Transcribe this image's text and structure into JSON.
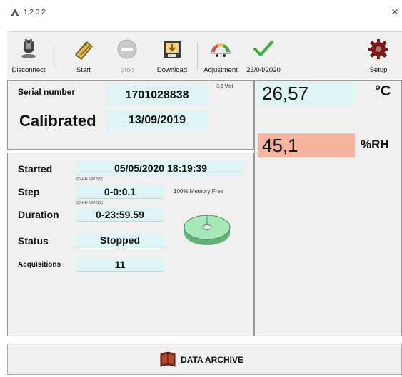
{
  "window": {
    "version": "1.2.0.2",
    "close_glyph": "×"
  },
  "toolbar": [
    {
      "label": "Disconnect",
      "icon": "plug-icon",
      "enabled": true
    },
    {
      "label": "Start",
      "icon": "start-icon",
      "enabled": true
    },
    {
      "label": "Stop",
      "icon": "stop-icon",
      "enabled": false
    },
    {
      "label": "Download",
      "icon": "download-icon",
      "enabled": true
    },
    {
      "label": "Adjustment",
      "icon": "gauge-icon",
      "enabled": true
    },
    {
      "label": "23/04/2020",
      "icon": "checkmark-icon",
      "enabled": true
    },
    {
      "label": "Setup",
      "icon": "gear-icon",
      "enabled": true
    }
  ],
  "device": {
    "serial_label": "Serial number",
    "serial_value": "1701028838",
    "voltage": "3,6 Volt",
    "calibrated_label": "Calibrated",
    "calibrated_value": "13/09/2019"
  },
  "acquisition": {
    "started_label": "Started",
    "started_value": "05/05/2020 18:19:39",
    "step_hint": "(D-HH MM SS)",
    "step_label": "Step",
    "step_value": "0-0:0.1",
    "duration_hint": "(D-HH MM.SS)",
    "duration_label": "Duration",
    "duration_value": "0-23:59.59",
    "status_label": "Status",
    "status_value": "Stopped",
    "acquisitions_label": "Acquisitions",
    "acquisitions_value": "11",
    "memory_text": "100% Memory Free",
    "memory_free_fraction": 1.0
  },
  "readings": {
    "temperature_value": "26,57",
    "temperature_unit": "°C",
    "humidity_value": "45,1",
    "humidity_unit": "%RH"
  },
  "colors": {
    "field_bg": "#dff5f5",
    "humidity_bg": "#f5b5a0",
    "disk_green": "#a8e8b8",
    "check_green": "#3cb043"
  },
  "archive": {
    "label": "DATA ARCHIVE",
    "icon": "archive-book-icon"
  }
}
